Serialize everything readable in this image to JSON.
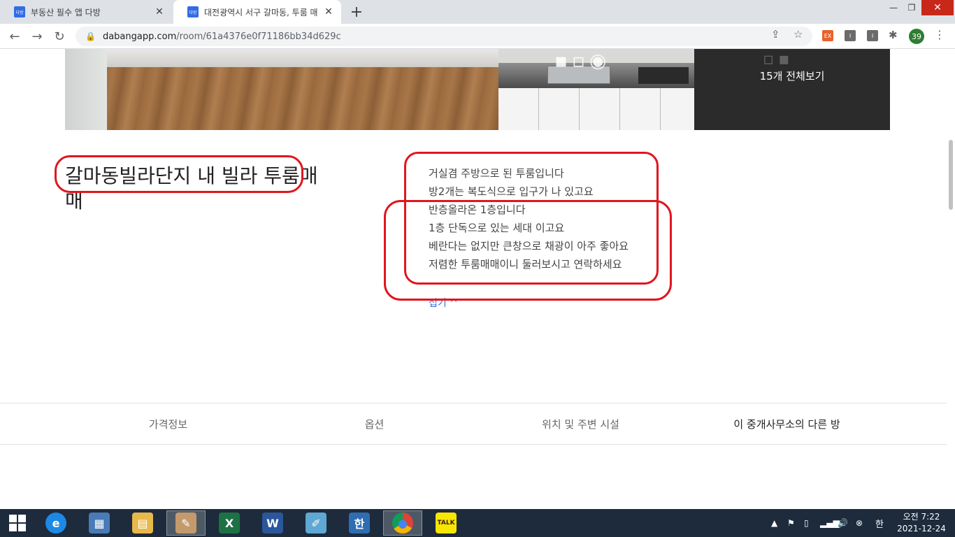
{
  "browser": {
    "tabs": [
      {
        "title": "부동산 필수 앱 다방",
        "favicon": "dabang",
        "active": false
      },
      {
        "title": "대전광역시 서구 갈마동, 투룸 매",
        "favicon": "dabang",
        "active": true
      }
    ],
    "new_tab": "+",
    "window_controls": {
      "minimize": "—",
      "restore": "❐",
      "close": "✕"
    },
    "url_domain": "dabangapp.com",
    "url_path": "/room/61a4376e0f71186bb34d629c",
    "extensions": [
      {
        "name": "ex-extension",
        "label": "EX",
        "color": "#e8622b"
      },
      {
        "name": "i-extension-1",
        "label": "I",
        "color": "#6b6b6b"
      },
      {
        "name": "i-extension-2",
        "label": "I",
        "color": "#6b6b6b"
      }
    ],
    "profile_badge": "39"
  },
  "gallery": {
    "more_label": "15개 전체보기"
  },
  "room": {
    "title": "갈마동빌라단지 내 빌라 투룸매매",
    "description": [
      "거실겸 주방으로 된 투룸입니다",
      "방2개는 복도식으로 입구가 나 있고요",
      "반층올라온 1층입니다",
      "1층 단독으로 있는 세대 이고요",
      "베란다는 없지만 큰창으로 채광이 아주 좋아요",
      "저렴한 투룸매매이니 둘러보시고 연락하세요"
    ],
    "fold_link": "접기 ^"
  },
  "detail_tabs": [
    {
      "label": "가격정보",
      "selected": false
    },
    {
      "label": "옵션",
      "selected": false
    },
    {
      "label": "위치 및 주변 시설",
      "selected": false
    },
    {
      "label": "이 중개사무소의 다른 방",
      "selected": true
    }
  ],
  "colors": {
    "accent": "#326ce5",
    "annotation": "#e0161f",
    "taskbar": "#1d2b3c"
  },
  "taskbar": {
    "apps": [
      {
        "name": "internet-explorer-icon",
        "glyph": "e",
        "color": "#1e88e5",
        "active": false
      },
      {
        "name": "control-panel-icon",
        "glyph": "▦",
        "color": "#4a7bb7",
        "active": false
      },
      {
        "name": "file-explorer-icon",
        "glyph": "▤",
        "color": "#e8b84a",
        "active": false
      },
      {
        "name": "paint-icon",
        "glyph": "✎",
        "color": "#c49a6c",
        "active": true
      },
      {
        "name": "excel-icon",
        "glyph": "X",
        "color": "#1e7145",
        "active": false
      },
      {
        "name": "word-icon",
        "glyph": "W",
        "color": "#2b579a",
        "active": false
      },
      {
        "name": "notepad-icon",
        "glyph": "✐",
        "color": "#5fa8d3",
        "active": false
      },
      {
        "name": "hangul-icon",
        "glyph": "한",
        "color": "#2f6db3",
        "active": false
      },
      {
        "name": "chrome-icon",
        "glyph": "●",
        "color": "#db4437",
        "active": true
      },
      {
        "name": "kakaotalk-icon",
        "glyph": "TALK",
        "color": "#f7e600",
        "active": false
      }
    ],
    "ime": "한",
    "clock_time": "오전 7:22",
    "clock_date": "2021-12-24"
  }
}
